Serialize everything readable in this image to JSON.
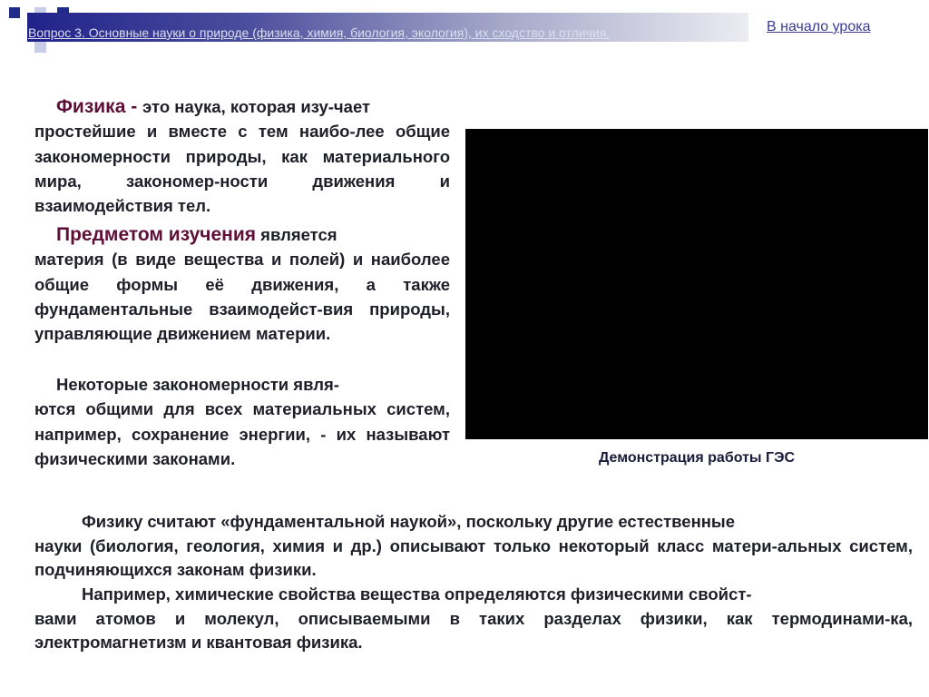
{
  "header": {
    "title": "Вопрос 3. Основные науки о природе (физика, химия, биология, экология), их сходство и отличия.",
    "nav_link": "В начало урока"
  },
  "paragraphs": [
    {
      "lead": "Физика - ",
      "first": "это наука, которая изу-чает",
      "rest": "простейшие и вместе с тем наибо-лее общие закономерности природы, как материального мира, закономер-ности движения и взаимодействия тел."
    },
    {
      "lead": "Предметом изучения",
      "first": " является",
      "rest": "материя (в виде вещества и полей) и наиболее общие формы её движения, а также фундаментальные взаимодейст-вия природы, управляющие движением материи."
    },
    {
      "first": "Некоторые закономерности явля-",
      "rest": "ются общими для всех материальных систем, например, сохранение энергии, - их называют физическими законами."
    }
  ],
  "media": {
    "caption": "Демонстрация работы ГЭС"
  },
  "bottom": [
    {
      "first": "Физику считают «фундаментальной наукой», поскольку другие естественные",
      "rest": "науки (биология, геология, химия и др.) описывают только некоторый класс матери-альных систем, подчиняющихся законам физики."
    },
    {
      "first": "Например, химические свойства вещества определяются физическими свойст-",
      "rest": "вами атомов и молекул, описываемыми в таких разделах физики, как термодинами-ка, электромагнетизм и квантовая физика."
    }
  ]
}
